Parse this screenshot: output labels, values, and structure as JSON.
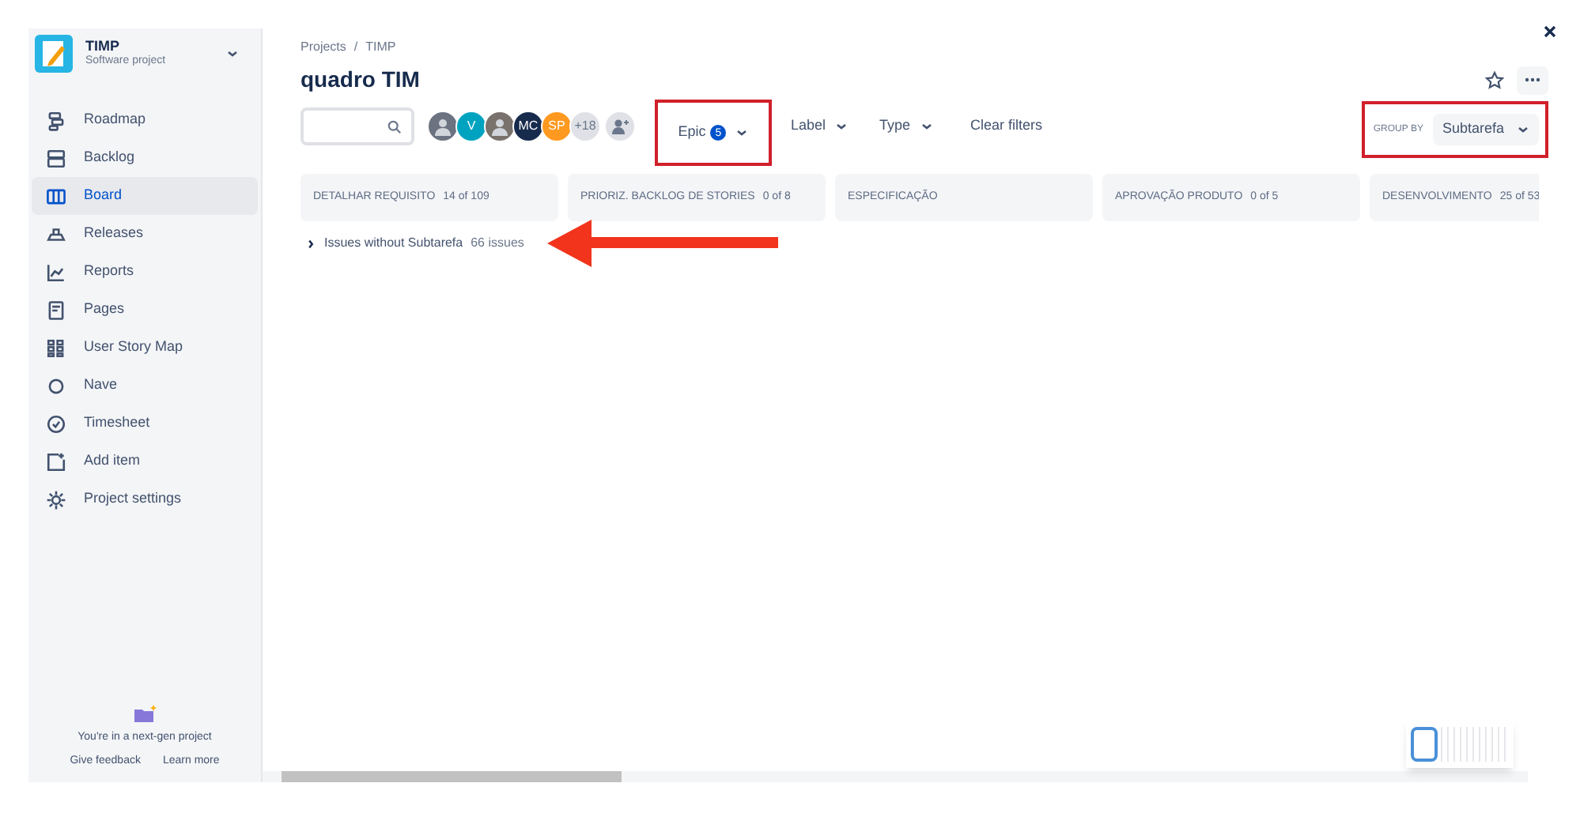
{
  "sidebar": {
    "project_name": "TIMP",
    "project_type": "Software project",
    "items": [
      {
        "label": "Roadmap",
        "kind": "roadmap",
        "selected": false
      },
      {
        "label": "Backlog",
        "kind": "backlog",
        "selected": false
      },
      {
        "label": "Board",
        "kind": "board",
        "selected": true
      },
      {
        "label": "Releases",
        "kind": "releases",
        "selected": false
      },
      {
        "label": "Reports",
        "kind": "reports",
        "selected": false
      },
      {
        "label": "Pages",
        "kind": "pages",
        "selected": false
      },
      {
        "label": "User Story Map",
        "kind": "map",
        "selected": false
      },
      {
        "label": "Nave",
        "kind": "circle",
        "selected": false
      },
      {
        "label": "Timesheet",
        "kind": "check",
        "selected": false
      },
      {
        "label": "Add item",
        "kind": "add",
        "selected": false
      },
      {
        "label": "Project settings",
        "kind": "gear",
        "selected": false
      }
    ],
    "footer": {
      "message": "You're in a next-gen project",
      "links": [
        "Give feedback",
        "Learn more"
      ]
    }
  },
  "breadcrumbs": [
    "Projects",
    "TIMP"
  ],
  "breadcrumb_separator": "/",
  "title": "quadro TIM",
  "avatars": [
    {
      "kind": "photo",
      "color": "#6b7280"
    },
    {
      "kind": "initials",
      "text": "V",
      "color": "#00a3bf"
    },
    {
      "kind": "photo",
      "color": "#78716c"
    },
    {
      "kind": "initials",
      "text": "MC",
      "color": "#172b4d"
    },
    {
      "kind": "initials",
      "text": "SP",
      "color": "#ff991f"
    },
    {
      "kind": "more",
      "text": "+18",
      "color": "#dfe1e6"
    },
    {
      "kind": "add",
      "color": "#dfe1e6"
    }
  ],
  "filters": [
    {
      "label": "Epic",
      "badge": "5",
      "highlighted": true
    },
    {
      "label": "Label",
      "highlighted": false
    },
    {
      "label": "Type",
      "highlighted": false
    }
  ],
  "clear_filters": "Clear filters",
  "group_by": {
    "label": "GROUP BY",
    "value": "Subtarefa"
  },
  "columns": [
    {
      "name": "DETALHAR REQUISITO",
      "count": "14 of 109"
    },
    {
      "name": "PRIORIZ. BACKLOG DE STORIES",
      "count": "0 of 8"
    },
    {
      "name": "ESPECIFICAÇÃO"
    },
    {
      "name": "APROVAÇÃO PRODUTO",
      "count": "0 of 5"
    },
    {
      "name": "DESENVOLVIMENTO",
      "count": "25 of 53"
    }
  ],
  "swimlane": {
    "label": "Issues without Subtarefa",
    "count": "66 issues",
    "expanded": false
  }
}
